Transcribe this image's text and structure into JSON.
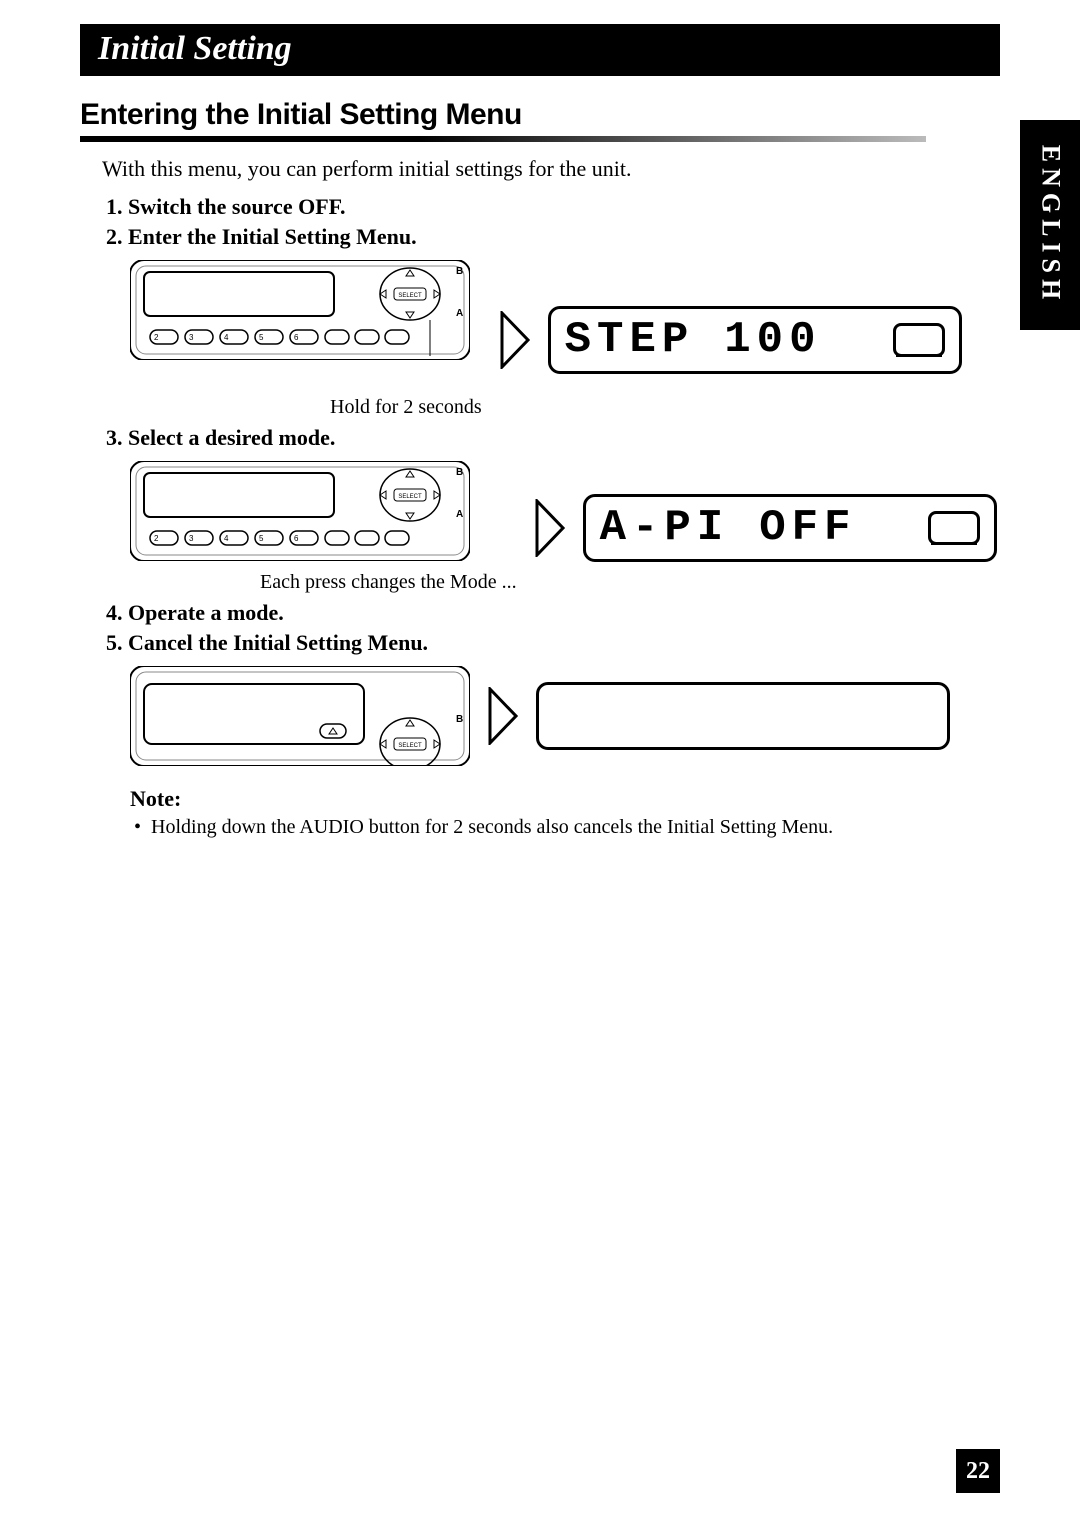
{
  "header": {
    "chapter": "Initial Setting"
  },
  "side_tab": "ENGLISH",
  "section": {
    "title": "Entering the Initial Setting Menu"
  },
  "intro": "With this menu, you can perform initial settings for the unit.",
  "steps": {
    "s1": "Switch the source OFF.",
    "s2": "Enter the Initial Setting Menu.",
    "s3": "Select a desired mode.",
    "s4": "Operate a mode.",
    "s5": "Cancel the Initial Setting Menu."
  },
  "step2": {
    "caption": "Hold for 2 seconds",
    "lcd_left": "STEP",
    "lcd_right": "100",
    "buttons": [
      "2",
      "3",
      "4",
      "5",
      "6"
    ],
    "labels": {
      "b": "B",
      "a": "A",
      "select": "SELECT"
    }
  },
  "step3": {
    "caption": "Each press changes the Mode ...",
    "lcd_left": "A-PI",
    "lcd_right": "OFF",
    "buttons": [
      "2",
      "3",
      "4",
      "5",
      "6"
    ],
    "labels": {
      "b": "B",
      "a": "A",
      "select": "SELECT"
    }
  },
  "step5": {
    "labels": {
      "b": "B",
      "select": "SELECT"
    }
  },
  "note": {
    "title": "Note:",
    "items": [
      "Holding down the AUDIO button for 2 seconds also cancels the Initial Setting Menu."
    ]
  },
  "page_number": "22"
}
